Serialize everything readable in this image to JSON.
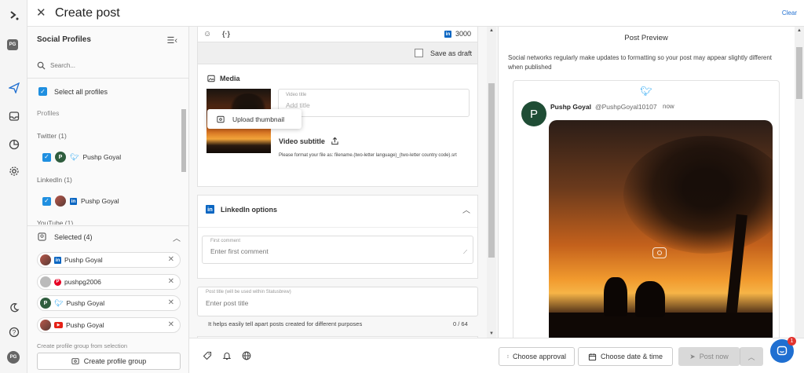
{
  "app": {
    "title": "Create post",
    "clear_label": "Clear"
  },
  "rail": {
    "avatar_top": "PG",
    "avatar_bottom": "PG"
  },
  "profiles": {
    "header": "Social Profiles",
    "search_placeholder": "Search...",
    "select_all": "Select all profiles",
    "section_profiles": "Profiles",
    "groups": [
      {
        "label": "Twitter (1)",
        "profile_name": "Pushp Goyal",
        "avatar": "P"
      },
      {
        "label": "LinkedIn (1)",
        "profile_name": "Pushp Goyal"
      },
      {
        "label": "YouTube (1)"
      }
    ],
    "selected_header": "Selected (4)",
    "selected": [
      {
        "name": "Pushp Goyal",
        "network": "linkedin"
      },
      {
        "name": "pushpg2006",
        "network": "pinterest"
      },
      {
        "name": "Pushp Goyal",
        "network": "twitter",
        "avatar": "P"
      },
      {
        "name": "Pushp Goyal",
        "network": "youtube"
      }
    ],
    "group_note": "Create profile group from selection",
    "group_button": "Create profile group"
  },
  "editor": {
    "char_count": "3000",
    "save_as_draft": "Save as draft",
    "media_header": "Media",
    "upload_thumbnail": "Upload thumbnail",
    "video_title_label": "Video title",
    "video_title_placeholder": "Add title",
    "video_subtitle": "Video subtitle",
    "subtitle_note": "Please format your file as: filename.(two-letter language)_(two-letter country code).srt",
    "linkedin_options": "LinkedIn options",
    "first_comment_label": "First comment",
    "first_comment_placeholder": "Enter first comment",
    "post_title_label": "Post title (will be used within Statusbrew)",
    "post_title_placeholder": "Enter post title",
    "post_title_help": "It helps easily tell apart posts created for different purposes",
    "post_title_count": "0 / 64"
  },
  "preview": {
    "header": "Post Preview",
    "note": "Social networks regularly make updates to formatting so your post may appear slightly different when published",
    "name": "Pushp Goyal",
    "handle": "@PushpGoyal10107",
    "time": "now",
    "avatar": "P"
  },
  "toolbar": {
    "choose_approval": "Choose approval",
    "choose_date": "Choose date & time",
    "post_now": "Post now"
  },
  "chat_badge": "1",
  "colors": {
    "accent": "#1f8fe0",
    "twitter": "#1da1f2",
    "linkedin": "#0a66c2"
  }
}
